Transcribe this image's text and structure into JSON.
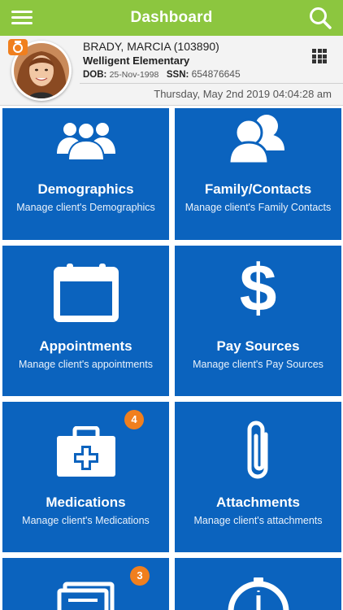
{
  "app": {
    "title": "Dashboard"
  },
  "client": {
    "name": "BRADY, MARCIA (103890)",
    "school": "Welligent Elementary",
    "dob_label": "DOB:",
    "dob": "25-Nov-1998",
    "ssn_label": "SSN:",
    "ssn": "654876645",
    "datetime": "Thursday, May 2nd 2019 04:04:28 am"
  },
  "colors": {
    "topbar": "#8cc63f",
    "tile": "#0b63be",
    "badge": "#f07f1e"
  },
  "tiles": [
    {
      "title": "Demographics",
      "subtitle": "Manage client's Demographics",
      "icon": "people-group-icon"
    },
    {
      "title": "Family/Contacts",
      "subtitle": "Manage client's Family Contacts",
      "icon": "contacts-icon"
    },
    {
      "title": "Appointments",
      "subtitle": "Manage client's appointments",
      "icon": "calendar-icon"
    },
    {
      "title": "Pay Sources",
      "subtitle": "Manage client's Pay Sources",
      "icon": "dollar-icon"
    },
    {
      "title": "Medications",
      "subtitle": "Manage client's Medications",
      "icon": "medical-kit-icon",
      "badge": "4"
    },
    {
      "title": "Attachments",
      "subtitle": "Manage client's attachments",
      "icon": "paperclip-icon"
    },
    {
      "title": "",
      "subtitle": "",
      "icon": "documents-icon",
      "badge": "3"
    },
    {
      "title": "",
      "subtitle": "",
      "icon": "clock-icon"
    }
  ]
}
